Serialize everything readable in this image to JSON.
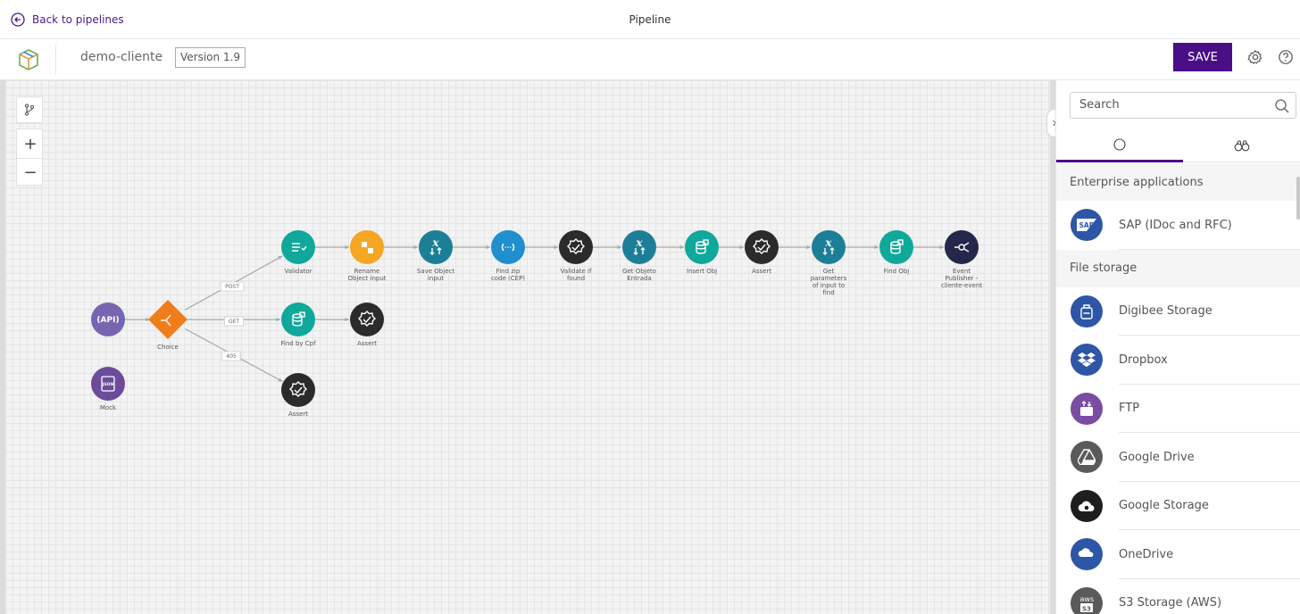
{
  "topbar": {
    "back_label": "Back to pipelines",
    "title": "Pipeline"
  },
  "header": {
    "project_name": "demo-cliente",
    "version": "Version 1.9",
    "save_label": "SAVE"
  },
  "colors": {
    "primary": "#4a0e86",
    "teal": "#10a89a",
    "orange": "#f07d1a",
    "yellow": "#f5a623",
    "blue_teal": "#1d7f97",
    "blue": "#1f8fcf",
    "dark": "#2b2b2b",
    "api": "#7865b2",
    "mock": "#6b4c9a",
    "event": "#24264a"
  },
  "canvas": {
    "nodes": [
      {
        "id": "api",
        "label": "",
        "icon": "API",
        "color": "api"
      },
      {
        "id": "mock",
        "label": "Mock",
        "icon": "JSON",
        "color": "mock"
      },
      {
        "id": "choice",
        "label": "Choice",
        "icon": "choice-icon",
        "color": "orange"
      },
      {
        "id": "validator",
        "label": "Validator",
        "icon": "list-check-icon",
        "color": "teal"
      },
      {
        "id": "rename",
        "label": "Rename Object input",
        "icon": "rename-icon",
        "color": "yellow"
      },
      {
        "id": "save_object",
        "label": "Save Object input",
        "icon": "transformer-icon",
        "color": "blue_teal"
      },
      {
        "id": "find_zip",
        "label": "Find zip code (CEP)",
        "icon": "rest-icon",
        "color": "blue"
      },
      {
        "id": "validate_found",
        "label": "Validate if found",
        "icon": "assert-icon",
        "color": "dark"
      },
      {
        "id": "get_objeto",
        "label": "Get Objeto Entrada",
        "icon": "transformer-icon",
        "color": "blue_teal"
      },
      {
        "id": "insert_obj",
        "label": "Insert Obj",
        "icon": "db-icon",
        "color": "teal"
      },
      {
        "id": "assert1",
        "label": "Assert",
        "icon": "assert-icon",
        "color": "dark"
      },
      {
        "id": "get_params",
        "label": "Get parameters of input to find",
        "icon": "transformer-icon",
        "color": "blue_teal"
      },
      {
        "id": "find_obj",
        "label": "Find Obj",
        "icon": "db-icon",
        "color": "teal"
      },
      {
        "id": "event_pub",
        "label": "Event Publisher - cliente-event",
        "icon": "event-icon",
        "color": "event"
      },
      {
        "id": "find_cpf",
        "label": "Find by Cpf",
        "icon": "db-icon",
        "color": "teal"
      },
      {
        "id": "assert2",
        "label": "Assert",
        "icon": "assert-icon",
        "color": "dark"
      },
      {
        "id": "assert3",
        "label": "Assert",
        "icon": "assert-icon",
        "color": "dark"
      }
    ],
    "edge_labels": [
      "POST",
      "GET",
      "405"
    ]
  },
  "sidebar": {
    "search_placeholder": "Search",
    "tabs": [
      {
        "icon": "circle-icon"
      },
      {
        "icon": "binoculars-icon"
      }
    ],
    "sections": [
      {
        "title": "Enterprise applications",
        "items": [
          {
            "label": "SAP (IDoc and RFC)",
            "icon": "sap-icon"
          }
        ]
      },
      {
        "title": "File storage",
        "items": [
          {
            "label": "Digibee Storage",
            "icon": "digibee-storage-icon"
          },
          {
            "label": "Dropbox",
            "icon": "dropbox-icon"
          },
          {
            "label": "FTP",
            "icon": "ftp-icon"
          },
          {
            "label": "Google Drive",
            "icon": "google-drive-icon"
          },
          {
            "label": "Google Storage",
            "icon": "google-storage-icon"
          },
          {
            "label": "OneDrive",
            "icon": "onedrive-icon"
          },
          {
            "label": "S3 Storage (AWS)",
            "icon": "s3-icon"
          }
        ]
      }
    ]
  }
}
